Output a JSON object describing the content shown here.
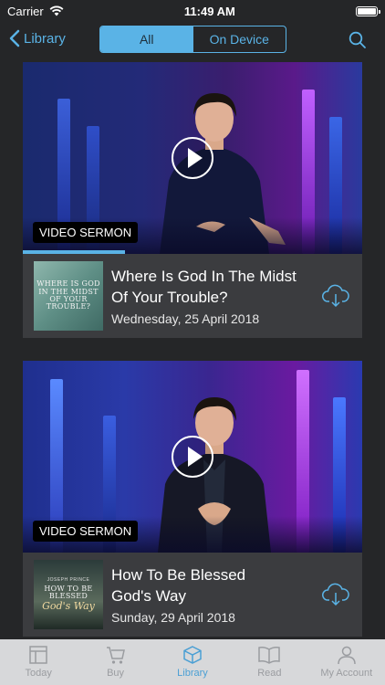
{
  "status": {
    "carrier": "Carrier",
    "time": "11:49 AM",
    "icons": [
      "wifi-icon",
      "battery-icon"
    ]
  },
  "nav": {
    "back_label": "Library",
    "segments": [
      {
        "label": "All",
        "active": true
      },
      {
        "label": "On Device",
        "active": false
      }
    ],
    "search_icon": "search-icon"
  },
  "sermons": [
    {
      "badge": "VIDEO SERMON",
      "title_line1": "Where Is God In The Midst",
      "title_line2": "Of Your Trouble?",
      "date": "Wednesday, 25 April 2018",
      "thumbnail_text": "WHERE IS GOD IN THE MIDST OF YOUR TROUBLE?",
      "progress": 0.3
    },
    {
      "badge": "VIDEO SERMON",
      "title_line1": "How To Be Blessed",
      "title_line2": "God's Way",
      "date": "Sunday, 29 April 2018",
      "thumbnail_author": "JOSEPH PRINCE",
      "thumbnail_line1": "HOW TO BE",
      "thumbnail_line2": "BLESSED",
      "thumbnail_script": "God's Way",
      "progress": 0
    }
  ],
  "tabs": [
    {
      "label": "Today",
      "icon": "today-icon",
      "active": false
    },
    {
      "label": "Buy",
      "icon": "cart-icon",
      "active": false
    },
    {
      "label": "Library",
      "icon": "library-box-icon",
      "active": true
    },
    {
      "label": "Read",
      "icon": "book-icon",
      "active": false
    },
    {
      "label": "My Account",
      "icon": "account-icon",
      "active": false
    }
  ],
  "colors": {
    "accent": "#5ab3e6",
    "background": "#252628",
    "card": "#3b3c3f",
    "tab_bar": "#d7d8da"
  }
}
